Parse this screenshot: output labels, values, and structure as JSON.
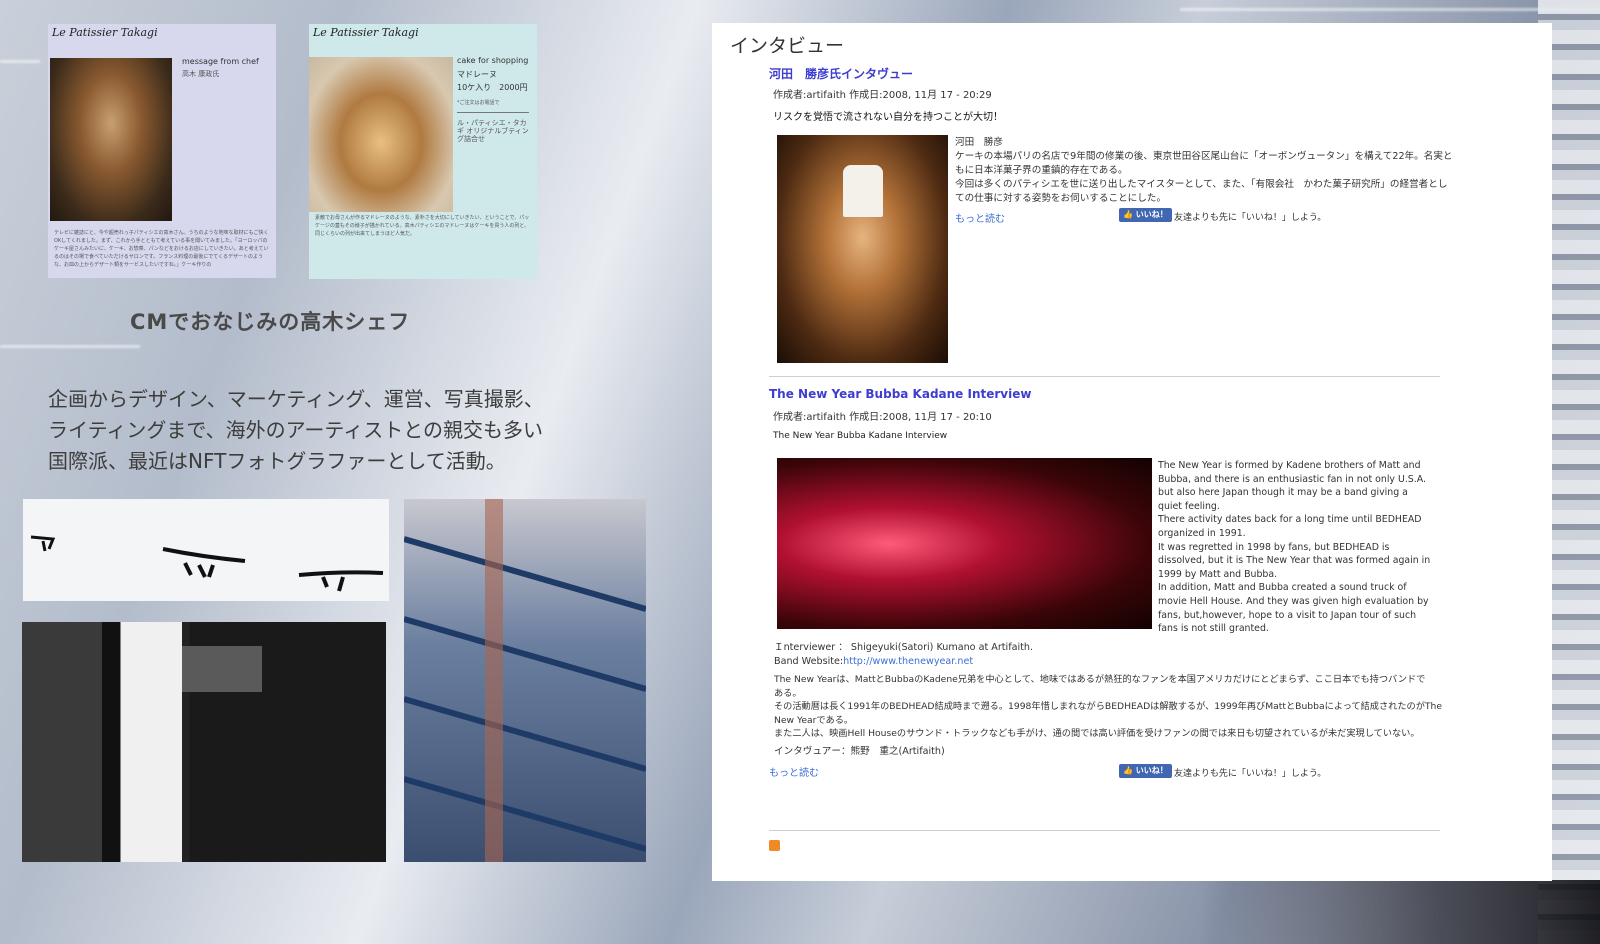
{
  "left": {
    "mag1": {
      "title": "Le Patissier Takagi",
      "message": "message from chef",
      "chef_name": "高木 康政氏",
      "body": "テレビに雑誌にと、今や超売れっ子パティシエの高木さん。うちのような地味な取材にもご快くOKしてくれました。まず、これから手とともて考えている事を聞いてみました。「ヨーロッパのケーキ屋さんみたいに、ケーキ、お惣菜、パンなどをおけるお店にしていきたい。あと考えているのはその場で食べていただけるサロンです。フランス料理の最後にでてくるデザートのような、お皿の上からデザート類をサービスしたいですね。」ケーキ作りの"
    },
    "mag2": {
      "title": "Le Patissier Takagi",
      "shop_label": "cake for shopping",
      "product": "マドレーヌ",
      "price": "10ケ入り　2000円",
      "note": "*ご注文はお電話で",
      "company": "ル・パティシエ・タカギ オリジナルブティング詰合せ",
      "body": "素敵でお母さんが作るマドレーヌのような、素朴さを大切にしていきたい、ということで、パッケージの蓋もその様子が描かれている。高木パティシエのマドレーヌはケーキを買う人の列と、同じくらいの列が出来てしまうほど人気だ。"
    },
    "caption": "CMでおなじみの高木シェフ",
    "bio": [
      "企画からデザイン、マーケティング、運営、写真撮影、",
      "ライティングまで、海外のアーティストとの親交も多い",
      "国際派、最近はNFTフォトグラファーとして活動。"
    ]
  },
  "blog": {
    "heading": "インタビュー",
    "post1": {
      "title": "河田　勝彦氏インタヴュー",
      "meta": "作成者:artifaith 作成日:2008, 11月 17 - 20:29",
      "lead": "リスクを覚悟で流されない自分を持つことが大切！",
      "name": "河田　勝彦",
      "body": [
        "ケーキの本場パリの名店で9年間の修業の後、東京世田谷区尾山台に「オーボンヴュータン」を構えて22年。名実と",
        "もに日本洋菓子界の重鎮的存在である。",
        "今回は多くのパティシエを世に送り出したマイスターとして、また、「有限会社　かわた菓子研究所」の経営者とし",
        "ての仕事に対する姿勢をお伺いすることにした。"
      ],
      "more": "もっと読む",
      "like": "いいね！",
      "like_text": "友達よりも先に「いいね！」しよう。"
    },
    "post2": {
      "title": "The New Year Bubba Kadane Interview",
      "meta": "作成者:artifaith 作成日:2008, 11月 17 - 20:10",
      "subtitle": "The New Year Bubba Kadane Interview",
      "body_en": [
        "The New Year is formed by Kadene brothers of Matt and",
        "Bubba, and there is an enthusiastic fan in not only U.S.A.",
        "but also here Japan though it may be a band giving a",
        "quiet feeling.",
        "There activity dates back for a long time until BEDHEAD",
        "organized in 1991.",
        "It was regretted in 1998 by fans, but BEDHEAD is",
        "dissolved, but it is The New Year that was formed again in",
        "1999 by Matt and Bubba.",
        "In addition, Matt and Bubba created a sound truck of",
        "movie Hell House. And they was given high evaluation by",
        "fans, but,however, hope to a visit to Japan tour of such",
        "fans is not still granted."
      ],
      "interviewer": "Ｉnterviewer ： Shigeyuki(Satori) Kumano at Artifaith.",
      "website_label": "Band Website:",
      "website_url": "http://www.thenewyear.net",
      "body_ja": [
        "The New Yearは、MattとBubbaのKadene兄弟を中心として、地味ではあるが熱狂的なファンを本国アメリカだけにとどまらず、ここ日本でも持つバンドで",
        "ある。",
        "その活動暦は長く1991年のBEDHEAD結成時まで遡る。1998年惜しまれながらBEDHEADは解散するが、1999年再びMattとBubbaによって結成されたのがThe",
        "New Yearである。",
        "また二人は、映画Hell Houseのサウンド・トラックなども手がけ、通の間では高い評価を受けファンの間では来日も切望されているが未だ実現していない。"
      ],
      "interviewer_ja": "インタヴュアー：熊野　重之(Artifaith)",
      "more": "もっと読む",
      "like": "いいね！",
      "like_text": "友達よりも先に「いいね！」しよう。"
    }
  }
}
